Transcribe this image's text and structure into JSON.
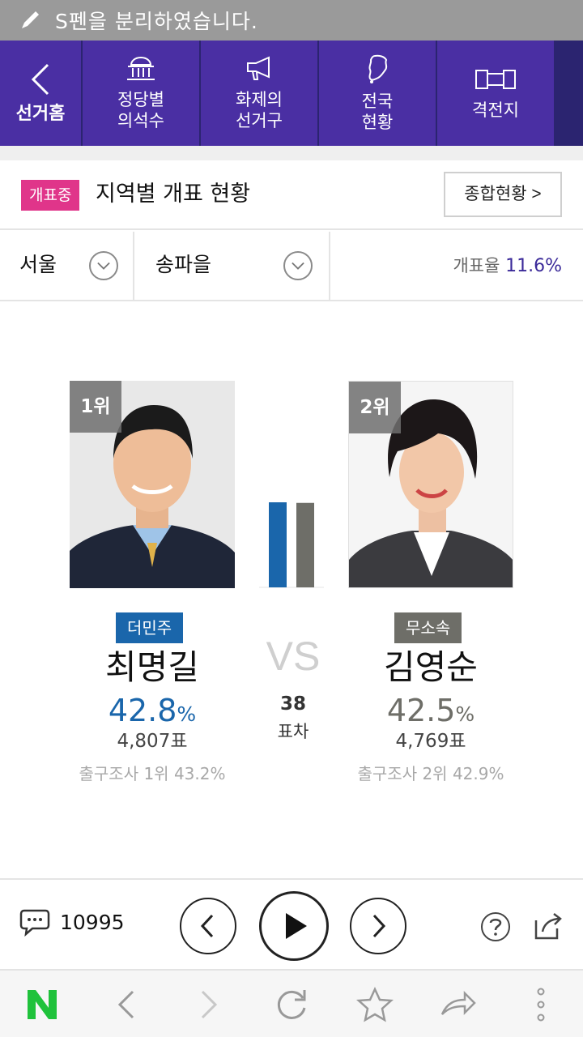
{
  "status_bar": {
    "message": "S펜을 분리하였습니다."
  },
  "nav": {
    "home_label": "선거홈",
    "items": [
      {
        "line1": "정당별",
        "line2": "의석수",
        "icon": "building-icon"
      },
      {
        "line1": "화제의",
        "line2": "선거구",
        "icon": "megaphone-icon"
      },
      {
        "line1": "전국",
        "line2": "현황",
        "icon": "map-icon"
      },
      {
        "line1": "격전지",
        "line2": "",
        "icon": "battle-icon"
      }
    ]
  },
  "header": {
    "badge": "개표중",
    "title": "지역별 개표 현황",
    "summary_button": "종합현황 >"
  },
  "selectors": {
    "region": "서울",
    "district": "송파을",
    "count_rate_label": "개표율",
    "count_rate_value": "11.6",
    "count_rate_unit": "%"
  },
  "candidates": [
    {
      "rank": "1위",
      "party": "더민주",
      "party_color": "#1a66ab",
      "name": "최명길",
      "pct": "42.8",
      "pct_unit": "%",
      "votes": "4,807표",
      "exit_poll": "출구조사 1위 43.2%"
    },
    {
      "rank": "2위",
      "party": "무소속",
      "party_color": "#6e6e68",
      "name": "김영순",
      "pct": "42.5",
      "pct_unit": "%",
      "votes": "4,769표",
      "exit_poll": "출구조사 2위 42.9%"
    }
  ],
  "comparison": {
    "vs": "VS",
    "margin_number": "38",
    "margin_label": "표차",
    "bar_values": [
      42.8,
      42.5
    ]
  },
  "controls": {
    "comment_count": "10995"
  },
  "browser": {
    "logo": "N"
  }
}
